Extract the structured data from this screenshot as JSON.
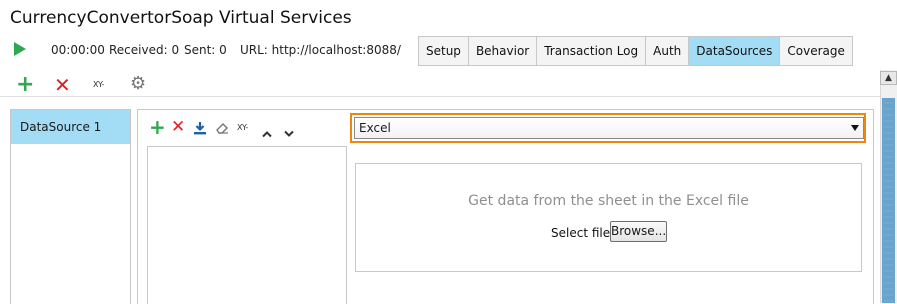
{
  "window": {
    "title": "CurrencyConvertorSoap Virtual Services"
  },
  "status": {
    "play_icon": "play-icon",
    "time": "00:00:00",
    "received": "Received: 0",
    "sent": "Sent: 0",
    "url": "URL: http://localhost:8088/"
  },
  "tabs": [
    {
      "label": "Setup"
    },
    {
      "label": "Behavior"
    },
    {
      "label": "Transaction Log"
    },
    {
      "label": "Auth"
    },
    {
      "label": "DataSources",
      "active": true
    },
    {
      "label": "Coverage"
    }
  ],
  "toolbar": {
    "xy_label": "XY-"
  },
  "datasources": {
    "items": [
      {
        "label": "DataSource 1"
      }
    ]
  },
  "inner_toolbar": {
    "xy_label": "XY-"
  },
  "source_type": {
    "selected": "Excel"
  },
  "excel": {
    "message": "Get data from the sheet in the Excel file",
    "select_file_label": "Select file:",
    "browse_label": "Browse..."
  },
  "colors": {
    "accent": "#a3dcf5",
    "highlight": "#f0860a",
    "add": "#2fa84f",
    "remove": "#e31e24"
  }
}
